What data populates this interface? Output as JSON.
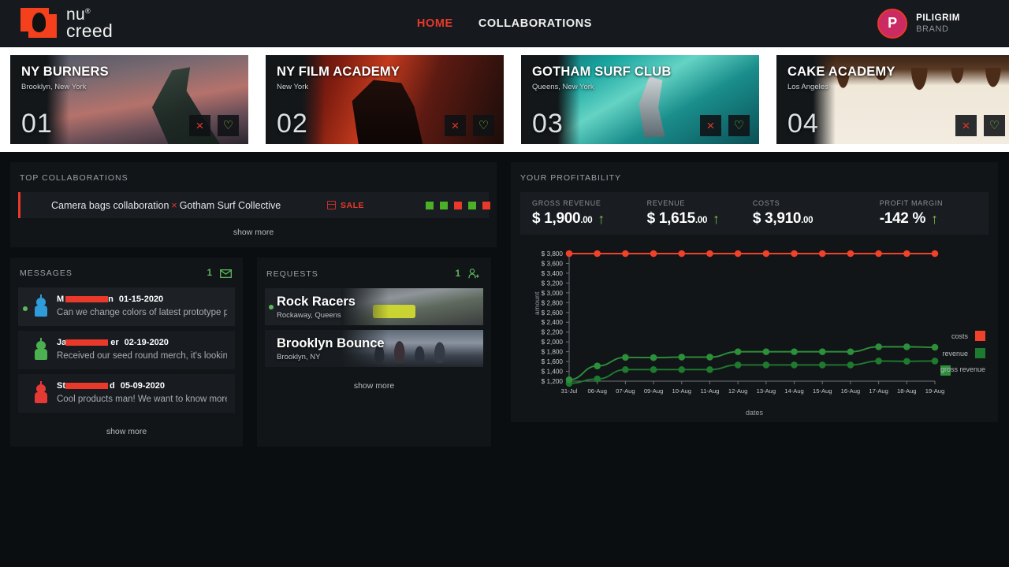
{
  "brand": {
    "line1": "nu",
    "line1_sup": "®",
    "line2": "creed"
  },
  "nav": {
    "items": [
      {
        "label": "HOME",
        "active": true
      },
      {
        "label": "COLLABORATIONS",
        "active": false
      }
    ]
  },
  "user": {
    "initial": "P",
    "name": "PILIGRIM",
    "role": "BRAND"
  },
  "cards": [
    {
      "title": "NY BURNERS",
      "location": "Brooklyn, New York",
      "number": "01",
      "photo": "whale-photo",
      "reject": "×",
      "like": "♡"
    },
    {
      "title": "NY FILM ACADEMY",
      "location": "New York",
      "number": "02",
      "photo": "film-photo",
      "reject": "×",
      "like": "♡"
    },
    {
      "title": "GOTHAM SURF CLUB",
      "location": "Queens, New York",
      "number": "03",
      "photo": "surf-photo",
      "reject": "×",
      "like": "♡"
    },
    {
      "title": "CAKE ACADEMY",
      "location": "Los Angeles",
      "number": "04",
      "photo": "cake-photo",
      "reject": "×",
      "like": "♡"
    }
  ],
  "top_collaborations": {
    "heading": "TOP COLLABORATIONS",
    "row": {
      "name_left": "Camera bags collaboration",
      "separator": "×",
      "name_right": "Gotham Surf Collective",
      "tag": "SALE",
      "statuses": [
        "#4caf28",
        "#4caf28",
        "#e8392a",
        "#4caf28",
        "#e8392a"
      ]
    },
    "show_more": "show more"
  },
  "messages": {
    "heading": "MESSAGES",
    "count": "1",
    "items": [
      {
        "name_prefix": "M",
        "name_suffix": "n",
        "date": "01-15-2020",
        "text": "Can we change colors of latest prototype please?",
        "unread": true,
        "avatar_color": "#2f9bd8"
      },
      {
        "name_prefix": "Ja",
        "name_suffix": "er",
        "date": "02-19-2020",
        "text": "Received our seed round merch, it's looking great!",
        "unread": false,
        "avatar_color": "#4caf50"
      },
      {
        "name_prefix": "St",
        "name_suffix": "d",
        "date": "05-09-2020",
        "text": "Cool products man! We want to know more",
        "unread": false,
        "avatar_color": "#e53935"
      }
    ],
    "show_more": "show more"
  },
  "requests": {
    "heading": "REQUESTS",
    "count": "1",
    "items": [
      {
        "name": "Rock Racers",
        "location": "Rockaway, Queens",
        "photo": "race-photo",
        "active": true
      },
      {
        "name": "Brooklyn Bounce",
        "location": "Brooklyn, NY",
        "photo": "bounce-photo",
        "active": false
      }
    ],
    "show_more": "show more"
  },
  "profitability": {
    "heading": "YOUR PROFITABILITY",
    "kpis": [
      {
        "label": "GROSS REVENUE",
        "currency": "$",
        "amount": "1,900",
        "cents": ".00",
        "arrow": "↑",
        "arrow_up": true
      },
      {
        "label": "REVENUE",
        "currency": "$",
        "amount": "1,615",
        "cents": ".00",
        "arrow": "↑",
        "arrow_up": true
      },
      {
        "label": "COSTS",
        "currency": "$",
        "amount": "3,910",
        "cents": ".00",
        "arrow": "",
        "arrow_up": false
      },
      {
        "label": "PROFIT MARGIN",
        "currency": "",
        "amount": "-142 %",
        "cents": "",
        "arrow": "↑",
        "arrow_up": true
      }
    ]
  },
  "chart_data": {
    "type": "line",
    "title": "",
    "xlabel": "dates",
    "ylabel": "amount",
    "x": [
      "31-Jul",
      "06-Aug",
      "07-Aug",
      "09-Aug",
      "10-Aug",
      "11-Aug",
      "12-Aug",
      "13-Aug",
      "14-Aug",
      "15-Aug",
      "16-Aug",
      "17-Aug",
      "18-Aug",
      "19-Aug"
    ],
    "ylim": [
      1200,
      3800
    ],
    "yticks": [
      "$ 1,200",
      "$ 1,400",
      "$ 1,600",
      "$ 1,800",
      "$ 2,000",
      "$ 2,200",
      "$ 2,400",
      "$ 2,600",
      "$ 2,800",
      "$ 3,000",
      "$ 3,200",
      "$ 3,400",
      "$ 3,600",
      "$ 3,800"
    ],
    "grid": false,
    "legend_position": "right",
    "series": [
      {
        "name": "costs",
        "color": "#f0422a",
        "values": [
          3800,
          3800,
          3800,
          3800,
          3800,
          3800,
          3800,
          3800,
          3800,
          3800,
          3800,
          3800,
          3800,
          3800
        ]
      },
      {
        "name": "revenue",
        "color": "#1e7a2e",
        "values": [
          1155,
          1245,
          1435,
          1435,
          1435,
          1435,
          1530,
          1530,
          1530,
          1530,
          1530,
          1610,
          1605,
          1610
        ]
      },
      {
        "name": "gross revenue",
        "color": "#2c8f3a",
        "values": [
          1230,
          1510,
          1685,
          1680,
          1690,
          1690,
          1800,
          1800,
          1800,
          1800,
          1800,
          1900,
          1900,
          1890
        ]
      }
    ]
  }
}
